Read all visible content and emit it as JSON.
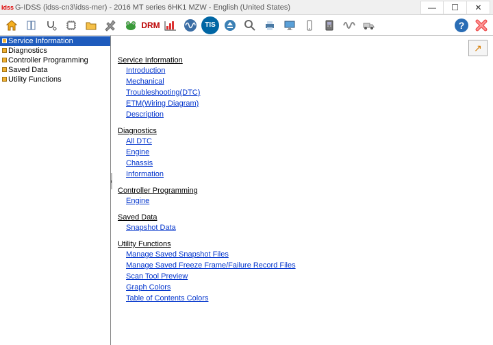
{
  "window": {
    "app_label": "Idss",
    "title": "G-IDSS (idss-cn3\\idss-mer) - 2016 MT series 6HK1 MZW - English (United States)",
    "min": "—",
    "max": "☐",
    "close": "✕"
  },
  "sidebar": {
    "items": [
      {
        "label": "Service Information"
      },
      {
        "label": "Diagnostics"
      },
      {
        "label": "Controller Programming"
      },
      {
        "label": "Saved Data"
      },
      {
        "label": "Utility Functions"
      }
    ]
  },
  "content": {
    "float_btn_glyph": "↗",
    "sections": [
      {
        "title": "Service Information",
        "links": [
          "Introduction",
          "Mechanical",
          "Troubleshooting(DTC)",
          "ETM(Wiring Diagram)",
          "Description"
        ]
      },
      {
        "title": "Diagnostics",
        "links": [
          "All DTC",
          "Engine",
          "Chassis",
          "Information"
        ]
      },
      {
        "title": "Controller Programming",
        "links": [
          "Engine"
        ]
      },
      {
        "title": "Saved Data",
        "links": [
          "Snapshot Data"
        ]
      },
      {
        "title": "Utility Functions",
        "links": [
          "Manage Saved Snapshot Files",
          "Manage Saved Freeze Frame/Failure Record Files",
          "Scan Tool Preview",
          "Graph Colors",
          "Table of Contents Colors"
        ]
      }
    ]
  },
  "drag_glyph": "◂"
}
